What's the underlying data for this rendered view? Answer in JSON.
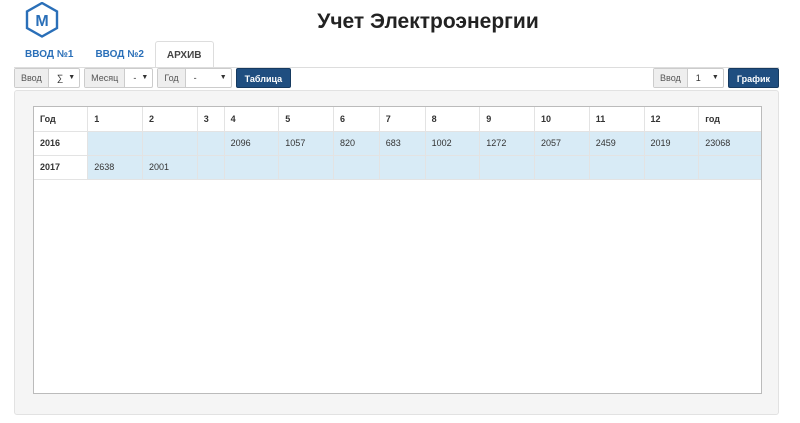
{
  "app": {
    "title": "Учет Электроэнергии",
    "logo_letter": "M",
    "brand_color": "#2a6fb8"
  },
  "tabs": [
    {
      "label": "ВВОД №1",
      "active": false
    },
    {
      "label": "ВВОД №2",
      "active": false
    },
    {
      "label": "АРХИВ",
      "active": true
    }
  ],
  "toolbar": {
    "vvod": {
      "label": "Ввод",
      "value": "∑"
    },
    "month": {
      "label": "Месяц",
      "value": "-"
    },
    "year": {
      "label": "Год",
      "value": "-"
    },
    "table_button": "Таблица",
    "vvod_right": {
      "label": "Ввод",
      "value": "1"
    },
    "chart_button": "График"
  },
  "table": {
    "headers": [
      "Год",
      "1",
      "2",
      "3",
      "4",
      "5",
      "6",
      "7",
      "8",
      "9",
      "10",
      "11",
      "12",
      "год"
    ],
    "rows": [
      {
        "year": "2016",
        "cells": [
          "",
          "",
          "",
          "2096",
          "1057",
          "820",
          "683",
          "1002",
          "1272",
          "2057",
          "2459",
          "2019",
          "23068"
        ]
      },
      {
        "year": "2017",
        "cells": [
          "2638",
          "2001",
          "",
          "",
          "",
          "",
          "",
          "",
          "",
          "",
          "",
          "",
          ""
        ]
      }
    ]
  },
  "colors": {
    "button": "#1f4e80",
    "row_highlight": "#d8ebf6"
  }
}
